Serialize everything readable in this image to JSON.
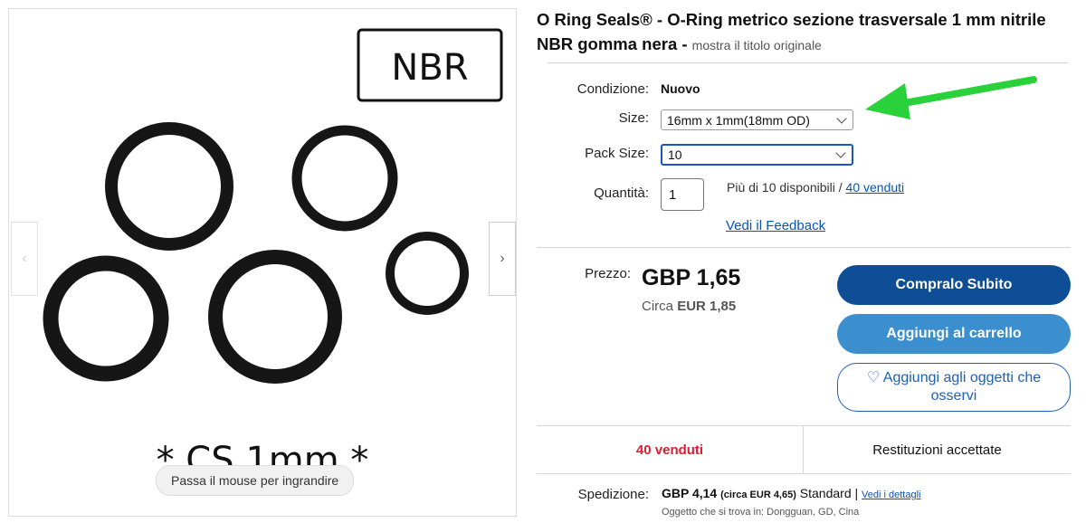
{
  "product": {
    "title": "O Ring Seals® - O-Ring metrico sezione trasversale 1 mm nitrile NBR gomma nera -",
    "original_title_link": "mostra il titolo originale",
    "image_label": "NBR",
    "image_caption": "* CS 1mm *"
  },
  "gallery": {
    "zoom_hint": "Passa il mouse per ingrandire",
    "prev_icon": "chevron-left-icon",
    "next_icon": "chevron-right-icon"
  },
  "details": {
    "condition_label": "Condizione:",
    "condition_value": "Nuovo",
    "size_label": "Size:",
    "size_value": "16mm x 1mm(18mm OD)",
    "pack_label": "Pack Size:",
    "pack_value": "10",
    "quantity_label": "Quantità:",
    "quantity_value": "1",
    "availability_text": "Più di 10 disponibili /",
    "sold_link": "40 venduti",
    "feedback_link": "Vedi il Feedback"
  },
  "price": {
    "label": "Prezzo:",
    "value": "GBP 1,65",
    "approx_prefix": "Circa",
    "approx_value": "EUR 1,85"
  },
  "actions": {
    "buy_now": "Compralo Subito",
    "add_to_cart": "Aggiungi al carrello",
    "watch": "♡ Aggiungi agli oggetti che osservi"
  },
  "stats": {
    "sold": "40 venduti",
    "returns": "Restituzioni accettate"
  },
  "shipping": {
    "label": "Spedizione:",
    "cost": "GBP 4,14",
    "approx": "(circa EUR 4,65)",
    "service": "Standard |",
    "details_link": "Vedi i dettagli",
    "location": "Oggetto che si trova in: Dongguan, GD, Cina"
  },
  "colors": {
    "buy_button": "#0e4e97",
    "cart_button": "#3b8fce",
    "link": "#0654ba",
    "sold_red": "#dd1e31",
    "annotation_arrow": "#29d13a"
  }
}
